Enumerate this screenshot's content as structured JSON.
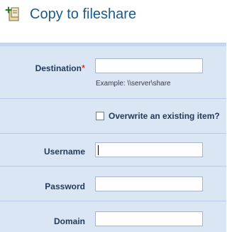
{
  "header": {
    "title": "Copy to fileshare",
    "icon": "fileshare-copy-icon"
  },
  "form": {
    "destination": {
      "label": "Destination",
      "required_mark": "*",
      "value": "",
      "hint": "Example: \\\\server\\share"
    },
    "overwrite": {
      "label": "Overwrite an existing item?",
      "checked": false
    },
    "username": {
      "label": "Username",
      "value": ""
    },
    "password": {
      "label": "Password",
      "value": ""
    },
    "domain": {
      "label": "Domain",
      "value": ""
    }
  },
  "colors": {
    "title": "#1c5a8a",
    "panel_bg": "#dae6f4",
    "label": "#243a5a",
    "required": "#cc0000"
  }
}
